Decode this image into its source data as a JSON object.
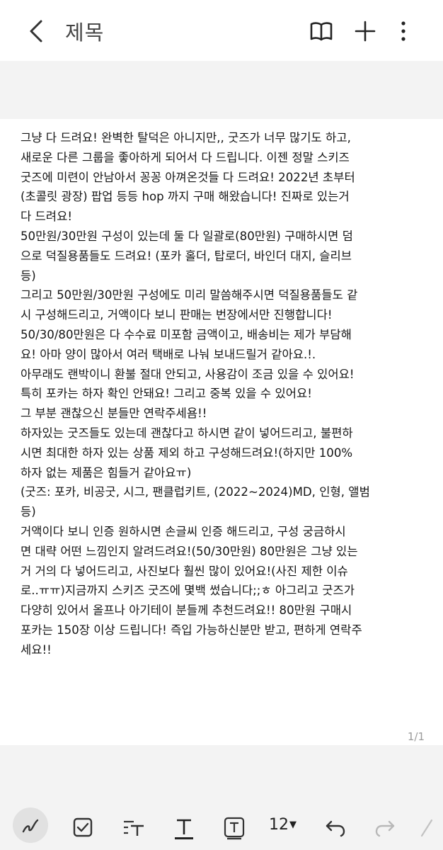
{
  "header": {
    "title": "제목"
  },
  "note": {
    "lines": [
      "그냥 다 드려요! 완벽한 탈덕은 아니지만,, 굿즈가 너무 많기도 하고,",
      "새로운 다른 그룹을 좋아하게 되어서 다 드립니다. 이젠 정말 스키즈",
      "굿즈에 미련이 안남아서 꽁꽁 아껴온것들 다 드려요! 2022년 초부터",
      "(초콜릿 광장) 팝업 등등 hop 까지 구매 해왔습니다! 진짜로 있는거",
      "다 드려요!",
      "50만원/30만원 구성이 있는데 둘 다 일괄로(80만원) 구매하시면 덤",
      "으로 덕질용품들도 드려요! (포카 홀더, 탑로더, 바인더 대지, 슬리브",
      "등)",
      "그리고 50만원/30만원 구성에도 미리 말씀해주시면 덕질용품들도 같",
      "시 구성해드리고, 거액이다 보니 판매는 번장에서만 진행합니다!",
      "50/30/80만원은 다 수수료 미포함 금액이고, 배송비는 제가 부담해",
      "요! 아마 양이 많아서 여러 택배로 나눠 보내드릴거 같아요.!.",
      "아무래도 랜박이니 환불 절대 안되고, 사용감이 조금 있을 수 있어요!",
      "특히 포카는 하자 확인 안돼요! 그리고 중복 있을 수 있어요!",
      "그 부분 괜찮으신 분들만 연락주세욤!!",
      "하자있는 굿즈들도 있는데 괜찮다고 하시면 같이 넣어드리고, 불편하",
      "시면 최대한 하자 있는 상품 제외 하고 구성해드려요!(하지만 100%",
      "하자 없는 제품은 힘들거 같아요ㅠ)",
      "(굿즈: 포카, 비공굿, 시그, 팬클럽키트, (2022~2024)MD, 인형, 앨범",
      "등)",
      "거액이다 보니 인증 원하시면 손글씨 인증 해드리고, 구성 궁금하시",
      "면 대략 어떤 느낌인지 알려드려요!(50/30만원) 80만원은 그냥 있는",
      "거 거의 다 넣어드리고, 사진보다 훨씬 많이 있어요!(사진 제한 이슈",
      "로..ㅠㅠ)지금까지 스키즈 굿즈에 몇백 썼습니다;;ㅎ 아그리고 굿즈가",
      "다양히 있어서 올프나 아기테이 분들께 추천드려요!! 80만원 구매시",
      "포카는 150장 이상 드립니다! 즉입 가능하신분만 받고, 편하게 연락주",
      "세요!!"
    ],
    "page_indicator": "1/1"
  },
  "toolbar": {
    "font_size": "12"
  },
  "icons": {
    "back": "chevron-left-icon",
    "reading_mode": "book-icon",
    "add": "plus-icon",
    "more": "more-vertical-icon"
  },
  "colors": {
    "background": "#f3f3f3",
    "note_background": "#ffffff"
  }
}
